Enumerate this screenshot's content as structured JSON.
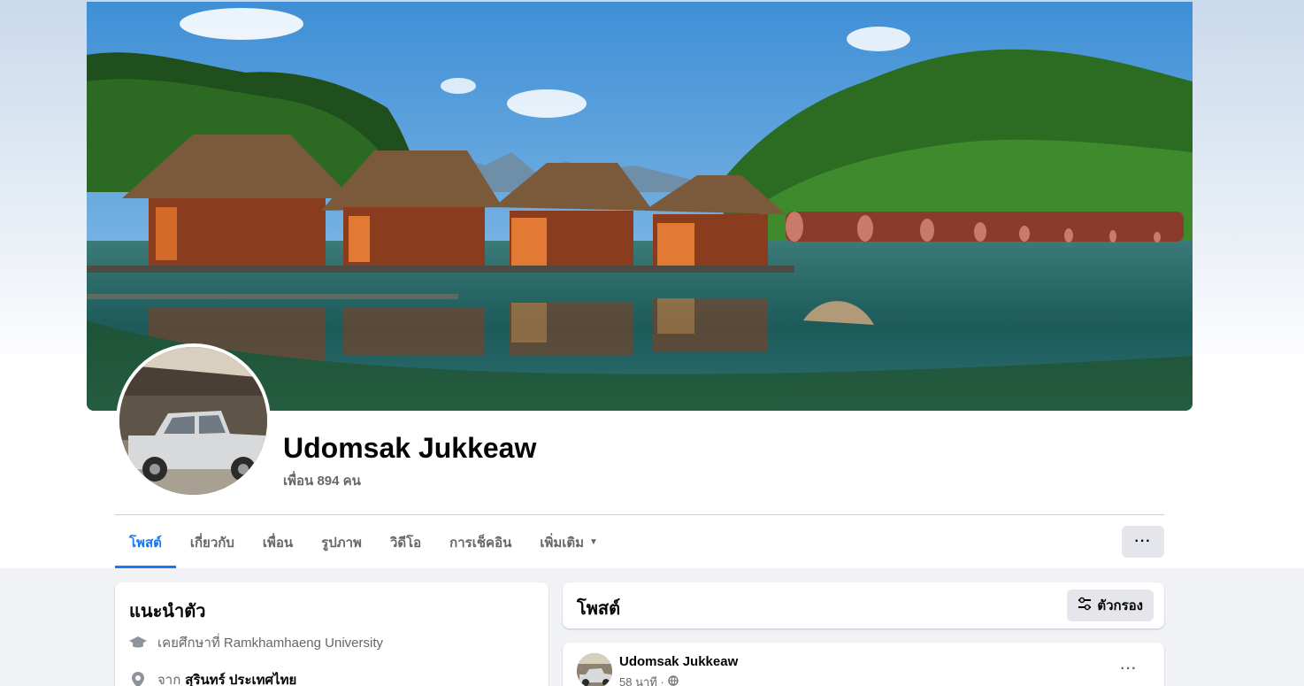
{
  "profile": {
    "name": "Udomsak Jukkeaw",
    "friends": "เพื่อน 894 คน"
  },
  "tabs": [
    {
      "label": "โพสต์"
    },
    {
      "label": "เกี่ยวกับ"
    },
    {
      "label": "เพื่อน"
    },
    {
      "label": "รูปภาพ"
    },
    {
      "label": "วิดีโอ"
    },
    {
      "label": "การเช็คอิน"
    },
    {
      "label": "เพิ่มเติม"
    }
  ],
  "tabs_more_label": "···",
  "intro": {
    "title": "แนะนำตัว",
    "education": "เคยศึกษาที่ Ramkhamhaeng University",
    "from_prefix": "จาก",
    "from_place": "สุรินทร์ ประเทศไทย"
  },
  "posts_header": {
    "title": "โพสต์",
    "filter_label": "ตัวกรอง"
  },
  "post": {
    "author": "Udomsak Jukkeaw",
    "time": "58 นาที ·",
    "more_label": "···"
  },
  "colors": {
    "accent": "#1877f2",
    "secondary_text": "#65676b",
    "button_bg": "#e4e6eb",
    "page_bg": "#f0f2f5"
  },
  "icons": {
    "education": "graduation-cap-icon",
    "location": "location-pin-icon",
    "filter": "filter-sliders-icon",
    "audience": "globe-icon",
    "more_tabs": "caret-down-icon"
  }
}
